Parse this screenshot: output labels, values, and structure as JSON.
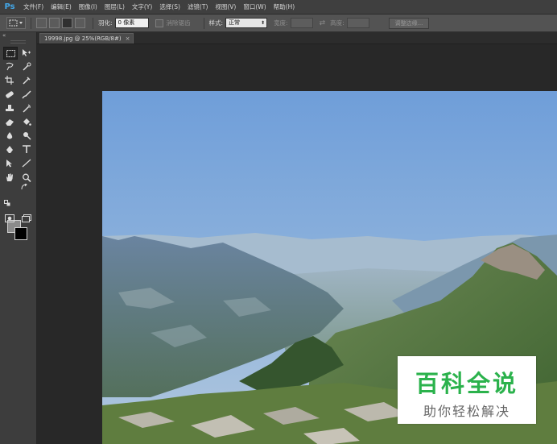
{
  "app": {
    "logo": "Ps"
  },
  "menu": [
    "文件(F)",
    "编辑(E)",
    "图像(I)",
    "图层(L)",
    "文字(Y)",
    "选择(S)",
    "滤镜(T)",
    "视图(V)",
    "窗口(W)",
    "帮助(H)"
  ],
  "options": {
    "feather_label": "羽化:",
    "feather_value": "0 像素",
    "antialias_label": "消除锯齿",
    "style_label": "样式:",
    "style_value": "正常",
    "width_label": "宽度:",
    "height_label": "高度:",
    "refine_edge": "调整边缘..."
  },
  "document": {
    "tab_title": "19998.jpg @ 25%(RGB/8#)",
    "close_glyph": "×"
  },
  "toolbox": {
    "collapse_glyph": "«"
  },
  "watermark": {
    "title": "百科全说",
    "subtitle": "助你轻松解决"
  },
  "colors": {
    "accent": "#43a7e8",
    "watermark_green": "#2bb24c"
  }
}
